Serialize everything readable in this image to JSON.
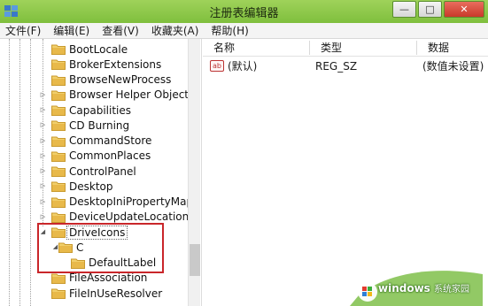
{
  "window": {
    "title": "注册表编辑器",
    "buttons": {
      "minimize": "—",
      "maximize": "□",
      "close": "✕"
    }
  },
  "menu": [
    "文件(F)",
    "编辑(E)",
    "查看(V)",
    "收藏夹(A)",
    "帮助(H)"
  ],
  "tree": {
    "nodes": [
      {
        "label": "BootLocale",
        "expander": ""
      },
      {
        "label": "BrokerExtensions",
        "expander": ""
      },
      {
        "label": "BrowseNewProcess",
        "expander": ""
      },
      {
        "label": "Browser Helper Objects",
        "expander": "▷"
      },
      {
        "label": "Capabilities",
        "expander": "▷"
      },
      {
        "label": "CD Burning",
        "expander": "▷"
      },
      {
        "label": "CommandStore",
        "expander": "▷"
      },
      {
        "label": "CommonPlaces",
        "expander": "▷"
      },
      {
        "label": "ControlPanel",
        "expander": "▷"
      },
      {
        "label": "Desktop",
        "expander": "▷"
      },
      {
        "label": "DesktopIniPropertyMap",
        "expander": "▷"
      },
      {
        "label": "DeviceUpdateLocations",
        "expander": "▷"
      },
      {
        "label": "DriveIcons",
        "expander": "◢"
      },
      {
        "label": "C",
        "expander": "◢"
      },
      {
        "label": "DefaultLabel",
        "expander": ""
      },
      {
        "label": "FileAssociation",
        "expander": ""
      },
      {
        "label": "FileInUseResolver",
        "expander": ""
      }
    ]
  },
  "list": {
    "columns": [
      "名称",
      "类型",
      "数据"
    ],
    "rows": [
      {
        "icon": "ab",
        "name": "(默认)",
        "type": "REG_SZ",
        "data": "(数值未设置)"
      }
    ]
  },
  "watermark": {
    "brand": "windows",
    "site": "系统家园"
  },
  "colors": {
    "titlebar": "#8fc94b",
    "highlight": "#c9262a",
    "folder": "#e8c25a"
  }
}
